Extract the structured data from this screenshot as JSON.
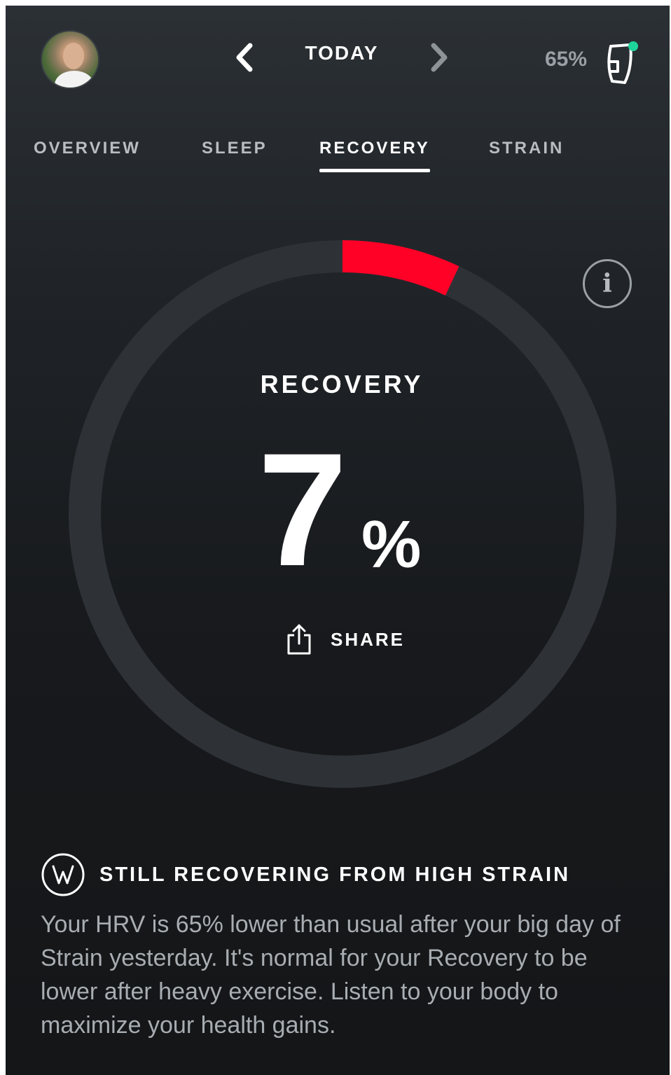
{
  "header": {
    "date_label": "TODAY",
    "battery": "65%",
    "icons": {
      "prev": "chevron-left-icon",
      "next": "chevron-right-icon",
      "band": "wristband-icon",
      "avatar": "user-avatar"
    },
    "colors": {
      "band_status": "#1fd49a"
    }
  },
  "tabs": [
    {
      "label": "OVERVIEW",
      "active": false
    },
    {
      "label": "SLEEP",
      "active": false
    },
    {
      "label": "RECOVERY",
      "active": true
    },
    {
      "label": "STRAIN",
      "active": false
    }
  ],
  "recovery": {
    "label": "RECOVERY",
    "value": "7",
    "unit": "%",
    "progress_percent": 7,
    "colors": {
      "progress": "#ff0026",
      "track": "#2e3236"
    },
    "info_icon": "info-icon",
    "share_label": "SHARE",
    "share_icon": "share-icon"
  },
  "insight": {
    "icon": "whoop-logo-icon",
    "title": "STILL RECOVERING FROM HIGH STRAIN",
    "body": "Your HRV is 65% lower than usual after your big day of Strain yesterday. It's normal for your Recovery to be lower after heavy exercise. Listen to your body to maximize your health gains."
  }
}
